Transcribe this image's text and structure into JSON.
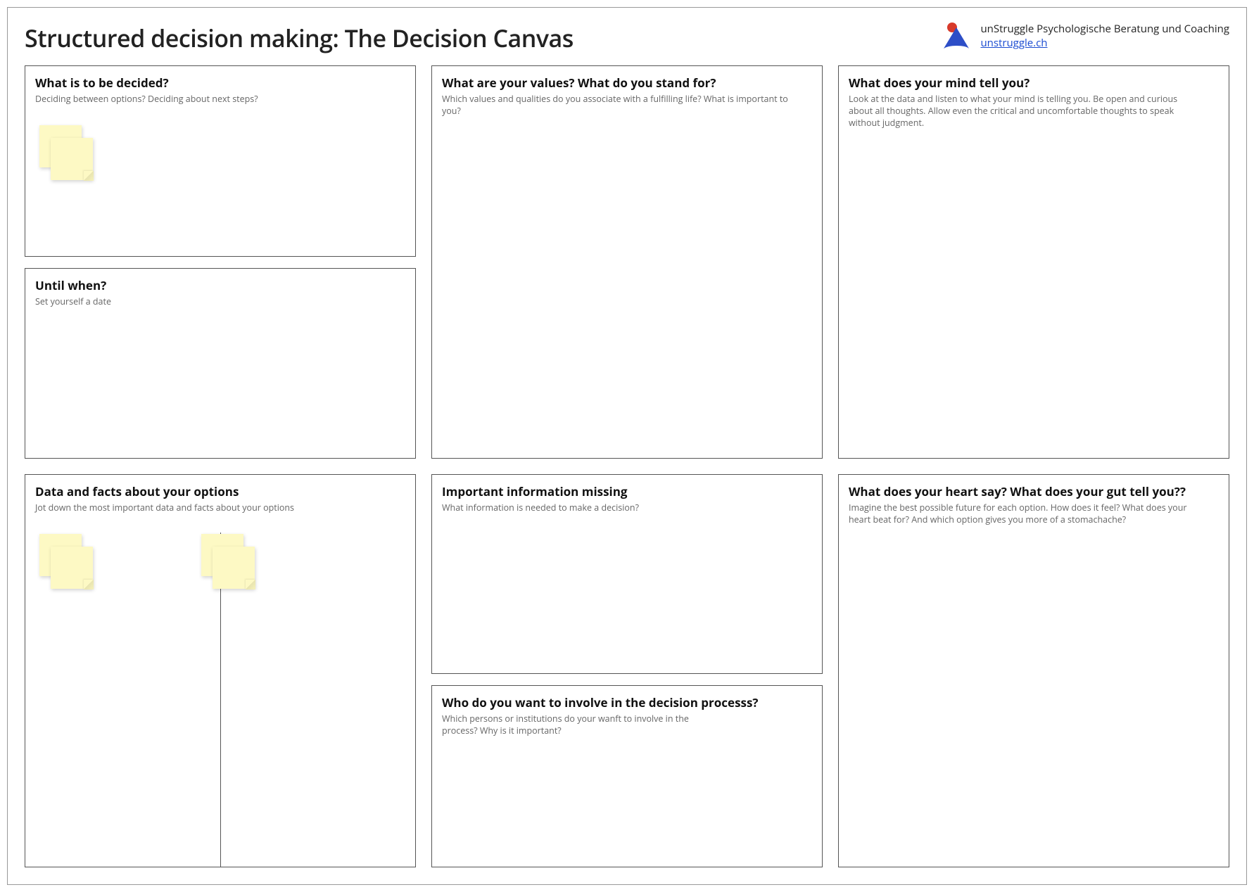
{
  "header": {
    "title": "Structured decision making: The Decision Canvas",
    "brand_name": "unStruggle Psychologische Beratung und Coaching",
    "brand_link": "unstruggle.ch"
  },
  "boxes": {
    "decide": {
      "title": "What is to be decided?",
      "sub": "Deciding between options? Deciding about next steps?"
    },
    "until": {
      "title": "Until when?",
      "sub": "Set yourself a date"
    },
    "values": {
      "title": "What are your values? What do you stand for?",
      "sub": "Which values and qualities do you associate with a fulfilling life? What is important to you?"
    },
    "mind": {
      "title": "What does your mind tell you?",
      "sub": "Look at the data and listen to what your mind is telling you. Be open and curious about all thoughts. Allow even the critical and uncomfortable thoughts to speak without judgment."
    },
    "data": {
      "title": "Data and facts about your options",
      "sub": "Jot down the most important data and facts about your options"
    },
    "missing": {
      "title": "Important information missing",
      "sub": "What information is needed to make a decision?"
    },
    "involve": {
      "title": "Who do you want to involve in the decision processs?",
      "sub": "Which persons or institutions do your wanft to involve in the process? Why is it important?"
    },
    "heart": {
      "title": "What does your heart say? What does your gut tell you??",
      "sub": "Imagine the best possible future for each option. How does it feel? What does your heart beat for? And which option gives you more of a stomachache?"
    }
  },
  "colors": {
    "logo_red": "#d83a2b",
    "logo_blue": "#2d4ec7",
    "sticky": "#fdf9c4"
  }
}
